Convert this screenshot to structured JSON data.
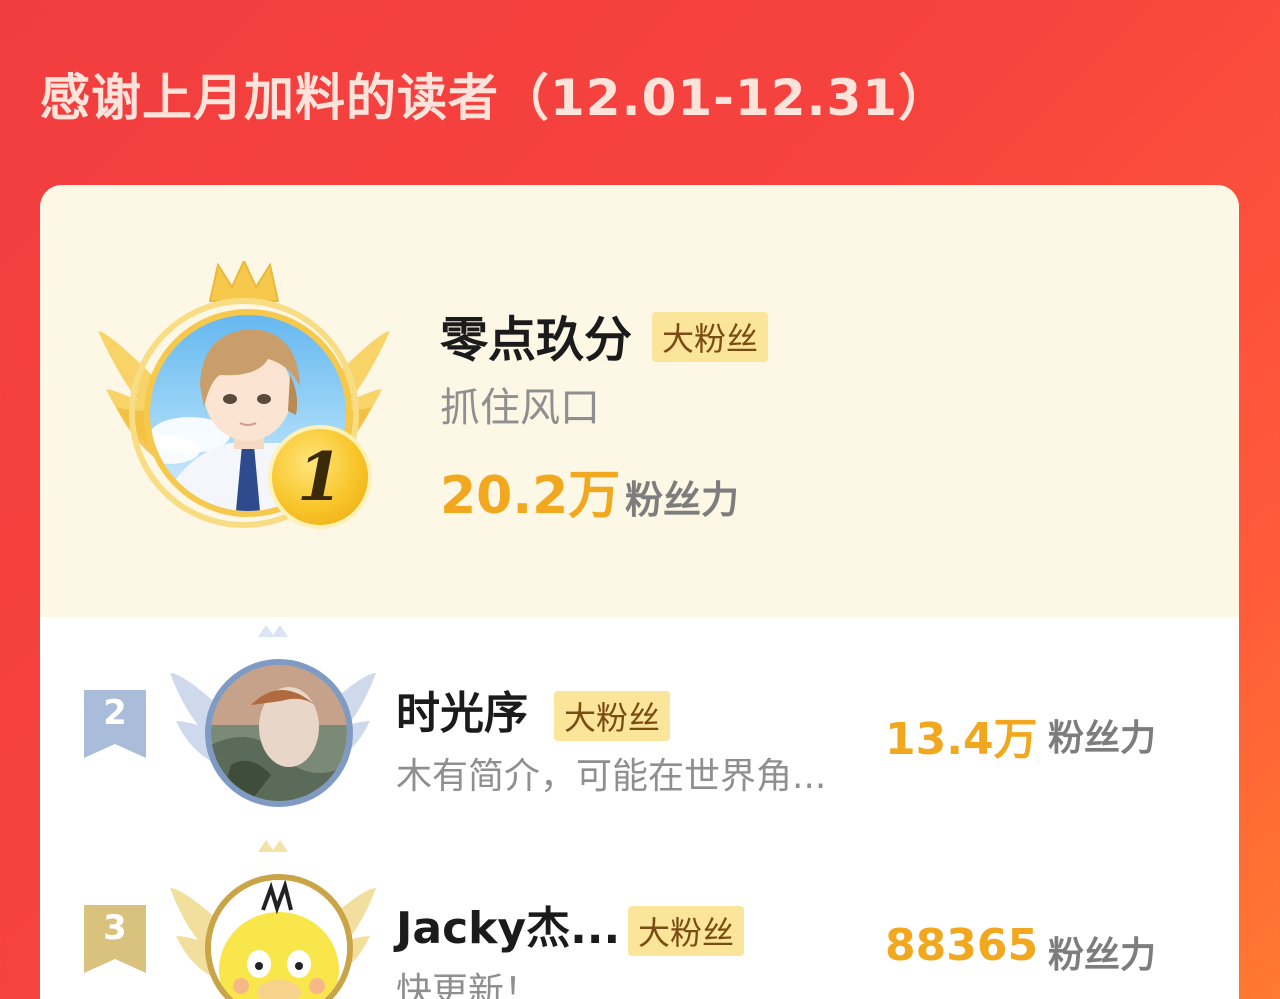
{
  "page_title": "感谢上月加料的读者（12.01-12.31）",
  "top_fan": {
    "rank": "1",
    "name": "零点玖分",
    "tag": "大粉丝",
    "bio": "抓住风口",
    "score": "20.2万",
    "unit": "粉丝力"
  },
  "fans": [
    {
      "rank": "2",
      "name": "时光序",
      "tag": "大粉丝",
      "bio": "木有简介，可能在世界角...",
      "score": "13.4万",
      "unit": "粉丝力"
    },
    {
      "rank": "3",
      "name": "Jacky杰...",
      "tag": "大粉丝",
      "bio": "快更新！",
      "score": "88365",
      "unit": "粉丝力"
    }
  ],
  "colors": {
    "background_red": "#f5403e",
    "card": "#ffffff",
    "top_section": "#fdf7e6",
    "gold": "#f2a81e",
    "tag_bg": "#fbe59a",
    "silver_flag": "#a9bcd9",
    "bronze_flag": "#d8c27e"
  },
  "icons": [
    "crown-icon",
    "wings-icon",
    "rank-medal-icon",
    "rank-flag-icon"
  ]
}
